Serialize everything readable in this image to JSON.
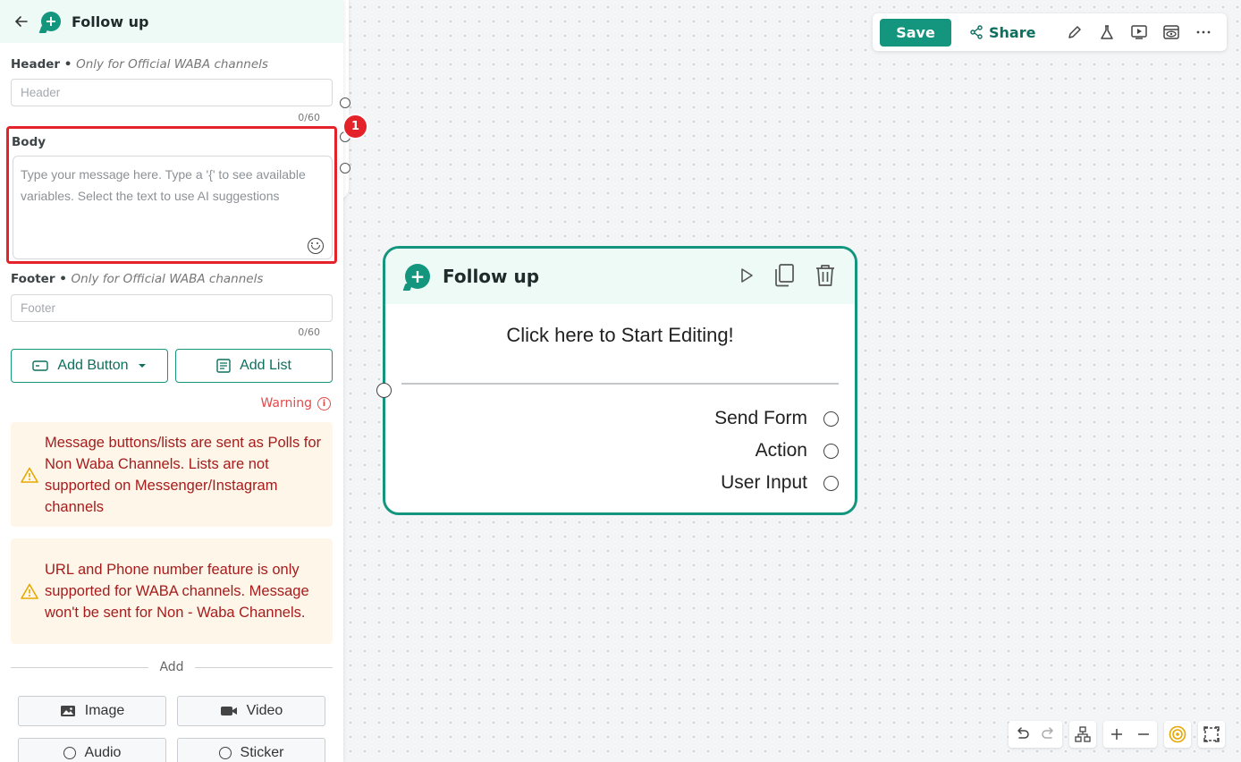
{
  "panel": {
    "title": "Follow up",
    "header": {
      "label": "Header",
      "sep": " • ",
      "note": "Only for Official WABA channels",
      "placeholder": "Header",
      "counter": "0/60"
    },
    "body": {
      "label": "Body",
      "placeholder": "Type your message here. Type a '{' to see available variables. Select the text to use AI suggestions"
    },
    "footer": {
      "label": "Footer",
      "sep": " • ",
      "note": "Only for Official WABA channels",
      "placeholder": "Footer",
      "counter": "0/60"
    },
    "add_button": "Add Button",
    "add_list": "Add List",
    "warning_link": "Warning",
    "warnings": [
      "Message buttons/lists are sent as Polls for Non Waba Channels. Lists are not supported on Messenger/Instagram channels",
      "URL and Phone number feature is only supported for WABA channels. Message won't be sent for Non - Waba Channels."
    ],
    "add_divider": "Add",
    "media": [
      {
        "label": "Image",
        "icon": "image-icon"
      },
      {
        "label": "Video",
        "icon": "video-icon"
      },
      {
        "label": "Audio",
        "icon": "audio-icon"
      },
      {
        "label": "Sticker",
        "icon": "sticker-icon"
      }
    ]
  },
  "annotation_badge": "1",
  "toolbar": {
    "save": "Save",
    "share": "Share"
  },
  "node": {
    "title": "Follow up",
    "cta": "Click here to Start Editing!",
    "outputs": [
      "Send Form",
      "Action",
      "User Input"
    ]
  },
  "colors": {
    "accent": "#14957e",
    "highlight": "#e4222a",
    "warning_text": "#a61c1c",
    "warning_bg": "#fff6ea"
  }
}
